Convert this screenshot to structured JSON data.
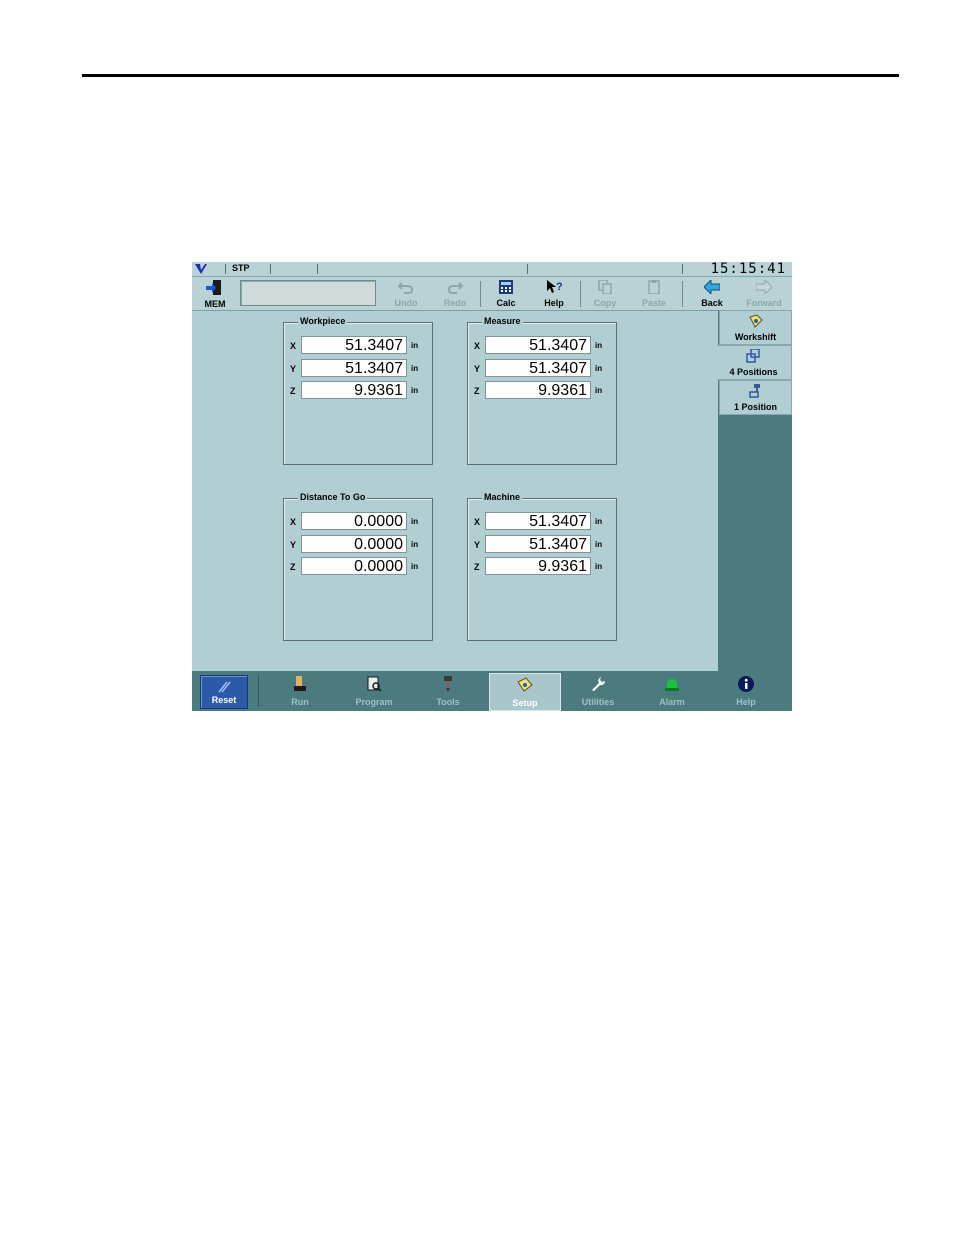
{
  "status": {
    "mode": "STP",
    "clock": "15:15:41"
  },
  "toolbar": {
    "mem_label": "MEM",
    "buttons": [
      {
        "label": "Undo",
        "enabled": false
      },
      {
        "label": "Redo",
        "enabled": false
      },
      {
        "label": "Calc",
        "enabled": true
      },
      {
        "label": "Help",
        "enabled": true
      },
      {
        "label": "Copy",
        "enabled": false
      },
      {
        "label": "Paste",
        "enabled": false
      },
      {
        "label": "Back",
        "enabled": true
      },
      {
        "label": "Forward",
        "enabled": false
      }
    ]
  },
  "side_tabs": [
    {
      "label": "Workshift"
    },
    {
      "label": "4 Positions",
      "active": true
    },
    {
      "label": "1 Position"
    }
  ],
  "groups": {
    "workpiece": {
      "title": "Workpiece",
      "rows": [
        {
          "axis": "X",
          "value": "51.3407",
          "unit": "in"
        },
        {
          "axis": "Y",
          "value": "51.3407",
          "unit": "in"
        },
        {
          "axis": "Z",
          "value": "9.9361",
          "unit": "in"
        }
      ]
    },
    "measure": {
      "title": "Measure",
      "rows": [
        {
          "axis": "X",
          "value": "51.3407",
          "unit": "in"
        },
        {
          "axis": "Y",
          "value": "51.3407",
          "unit": "in"
        },
        {
          "axis": "Z",
          "value": "9.9361",
          "unit": "in"
        }
      ]
    },
    "distance": {
      "title": "Distance To Go",
      "rows": [
        {
          "axis": "X",
          "value": "0.0000",
          "unit": "in"
        },
        {
          "axis": "Y",
          "value": "0.0000",
          "unit": "in"
        },
        {
          "axis": "Z",
          "value": "0.0000",
          "unit": "in"
        }
      ]
    },
    "machine": {
      "title": "Machine",
      "rows": [
        {
          "axis": "X",
          "value": "51.3407",
          "unit": "in"
        },
        {
          "axis": "Y",
          "value": "51.3407",
          "unit": "in"
        },
        {
          "axis": "Z",
          "value": "9.9361",
          "unit": "in"
        }
      ]
    }
  },
  "nav": {
    "reset": "Reset",
    "items": [
      {
        "label": "Run"
      },
      {
        "label": "Program"
      },
      {
        "label": "Tools"
      },
      {
        "label": "Setup",
        "active": true
      },
      {
        "label": "Utilities"
      },
      {
        "label": "Alarm"
      },
      {
        "label": "Help"
      }
    ]
  },
  "colors": {
    "screen_bg": "#b1cfd3",
    "panel": "#4b7b7e",
    "reset": "#2d5aa8",
    "alarm_green": "#19c43a"
  }
}
